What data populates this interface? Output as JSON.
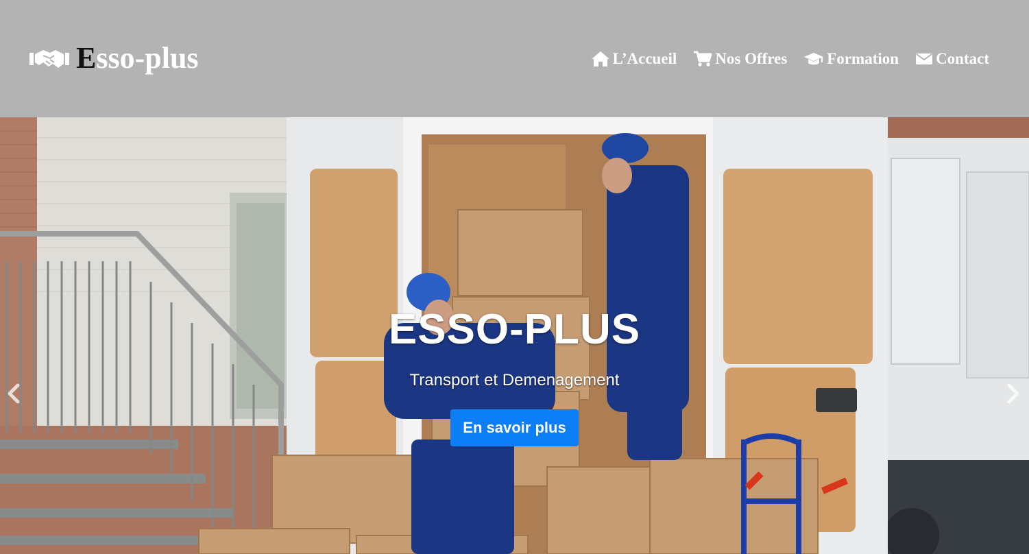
{
  "header": {
    "brand_first_letter": "E",
    "brand_rest": "sso-plus",
    "logo_icon": "handshake-icon"
  },
  "nav": {
    "items": [
      {
        "label": "L’Accueil",
        "icon": "home-icon"
      },
      {
        "label": "Nos Offres",
        "icon": "cart-icon"
      },
      {
        "label": "Formation",
        "icon": "graduation-cap-icon"
      },
      {
        "label": "Contact",
        "icon": "envelope-icon"
      }
    ]
  },
  "hero": {
    "title": "ESSO-PLUS",
    "subtitle": "Transport et Demenagement",
    "cta_label": "En savoir plus",
    "prev_icon": "chevron-left-icon",
    "next_icon": "chevron-right-icon"
  },
  "colors": {
    "navbar_bg": "#b3b3b3",
    "cta_bg": "#0d7ff6",
    "text_light": "#ffffff"
  }
}
